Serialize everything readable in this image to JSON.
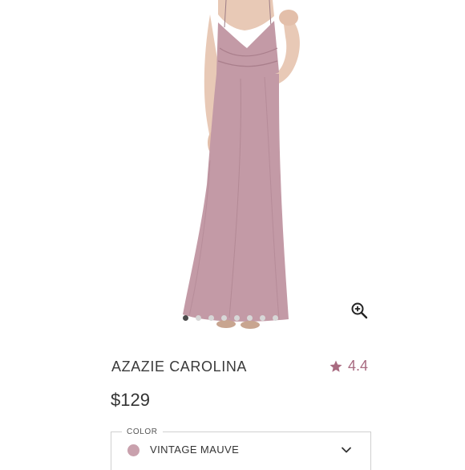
{
  "product": {
    "title": "AZAZIE CAROLINA",
    "rating": "4.4",
    "price": "$129"
  },
  "gallery": {
    "image_count": 8,
    "active_index": 0,
    "zoom_icon": "zoom-in-icon"
  },
  "color_field": {
    "legend": "COLOR",
    "value": "VINTAGE MAUVE",
    "swatch_color": "#c9a1ad",
    "dropdown_icon": "chevron-down-icon"
  },
  "colors": {
    "dress": "#c39aa6",
    "dress_shadow": "#a97e8b",
    "skin": "#e8c9b6",
    "accent": "#a86a80"
  }
}
